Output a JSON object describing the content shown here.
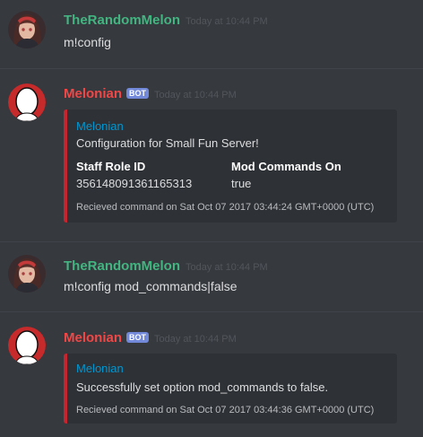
{
  "messages": [
    {
      "author": "TheRandomMelon",
      "timestamp": "Today at 10:44 PM",
      "content": "m!config",
      "avatar_icon": "anime-girl-avatar-icon"
    },
    {
      "author": "Melonian",
      "bot_tag": "BOT",
      "timestamp": "Today at 10:44 PM",
      "avatar_icon": "face-silhouette-avatar-icon",
      "embed": {
        "author": "Melonian",
        "description": "Configuration for Small Fun Server!",
        "fields": [
          {
            "name": "Staff Role ID",
            "value": "356148091361165313"
          },
          {
            "name": "Mod Commands On",
            "value": "true"
          }
        ],
        "footer": "Recieved command on Sat Oct 07 2017 03:44:24 GMT+0000 (UTC)"
      }
    },
    {
      "author": "TheRandomMelon",
      "timestamp": "Today at 10:44 PM",
      "content": "m!config mod_commands|false",
      "avatar_icon": "anime-girl-avatar-icon"
    },
    {
      "author": "Melonian",
      "bot_tag": "BOT",
      "timestamp": "Today at 10:44 PM",
      "avatar_icon": "face-silhouette-avatar-icon",
      "embed": {
        "author": "Melonian",
        "description": "Successfully set option mod_commands to false.",
        "footer": "Recieved command on Sat Oct 07 2017 03:44:36 GMT+0000 (UTC)"
      }
    }
  ],
  "colors": {
    "background": "#36393e",
    "user_name": "#43b581",
    "bot_name": "#f04747",
    "bot_tag": "#7289da",
    "embed_border": "#c5252f",
    "embed_author": "#0096cf",
    "timestamp": "#52555b",
    "text": "#dcddde"
  }
}
